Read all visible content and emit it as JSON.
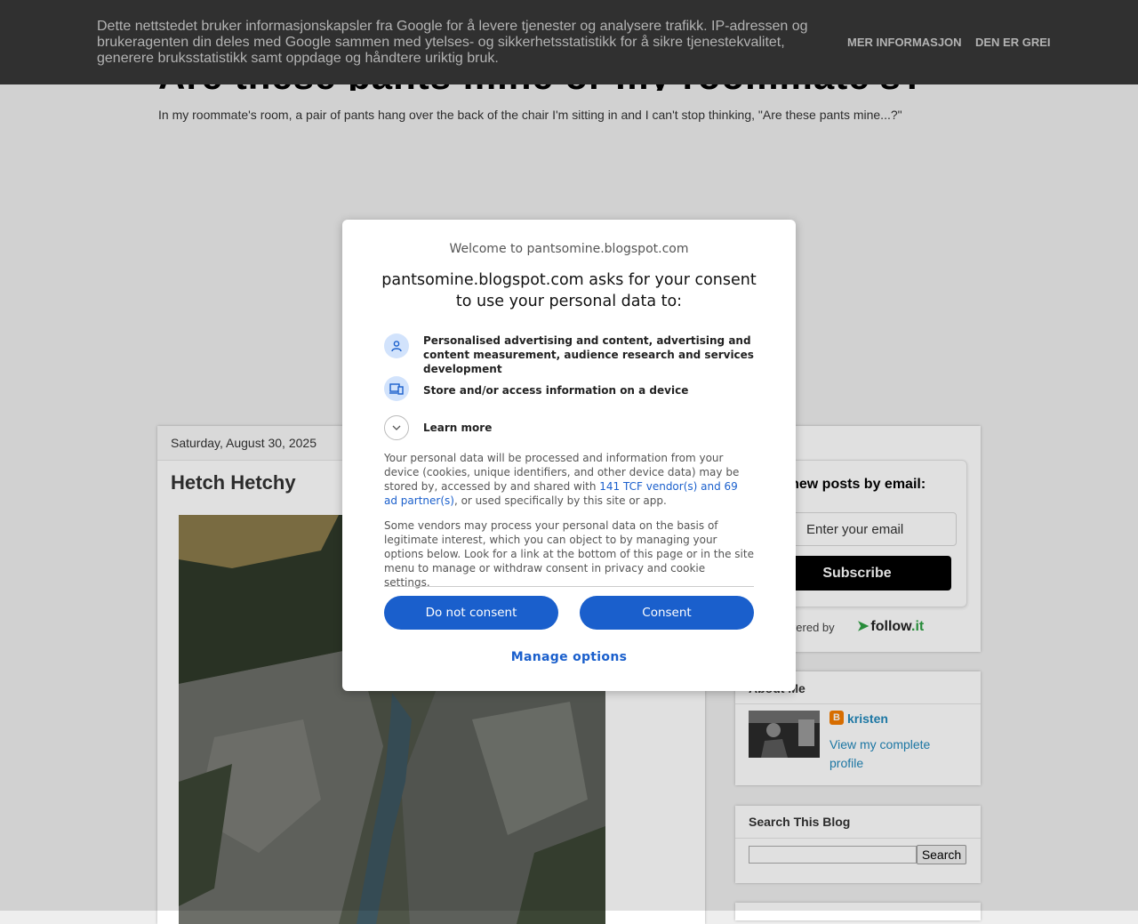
{
  "cookie_bar": {
    "text": "Dette nettstedet bruker informasjonskapsler fra Google for å levere tjenester og analysere trafikk. IP-adressen og brukeragenten din deles med Google sammen med ytelses- og sikkerhetsstatistikk for å sikre tjenestekvalitet, generere bruksstatistikk samt oppdage og håndtere uriktig bruk.",
    "more_info": "Mer informasjon",
    "accept": "Den er grei"
  },
  "blog": {
    "title": "Are these pants mine or my roommate's?",
    "description": "In my roommate's room, a pair of pants hang over the back of the chair I'm sitting in and I can't stop thinking, \"Are these pants mine...?\""
  },
  "post": {
    "date": "Saturday, August 30, 2025",
    "title": "Hetch Hetchy"
  },
  "sidebar": {
    "follow": {
      "heading": "Get new posts by email:",
      "email_placeholder": "Enter your email",
      "subscribe_label": "Subscribe",
      "powered_by": "Powered by",
      "logo_text": "follow",
      "logo_suffix": ".it"
    },
    "about": {
      "heading": "About Me",
      "name": "kristen",
      "profile_link": "View my complete profile"
    },
    "search": {
      "heading": "Search This Blog",
      "button_label": "Search"
    }
  },
  "consent": {
    "welcome": "Welcome to pantsomine.blogspot.com",
    "heading": "pantsomine.blogspot.com asks for your consent to use your personal data to:",
    "purposes": [
      {
        "icon": "person-icon",
        "text": "Personalised advertising and content, advertising and content measurement, audience research and services development"
      },
      {
        "icon": "devices-icon",
        "text": "Store and/or access information on a device"
      }
    ],
    "learn_more": "Learn more",
    "para1_before": "Your personal data will be processed and information from your device (cookies, unique identifiers, and other device data) may be stored by, accessed by and shared with ",
    "para1_link": "141 TCF vendor(s) and 69 ad partner(s)",
    "para1_after": ", or used specifically by this site or app.",
    "para2": "Some vendors may process your personal data on the basis of legitimate interest, which you can object to by managing your options below. Look for a link at the bottom of this page or in the site menu to manage or withdraw consent in privacy and cookie settings.",
    "do_not_consent": "Do not consent",
    "consent": "Consent",
    "manage_options": "Manage options"
  },
  "colors": {
    "consent_blue": "#1a5fcc",
    "cookie_bar_bg": "#303030",
    "link_blue": "#2288bb",
    "followit_green": "#2ea043"
  }
}
